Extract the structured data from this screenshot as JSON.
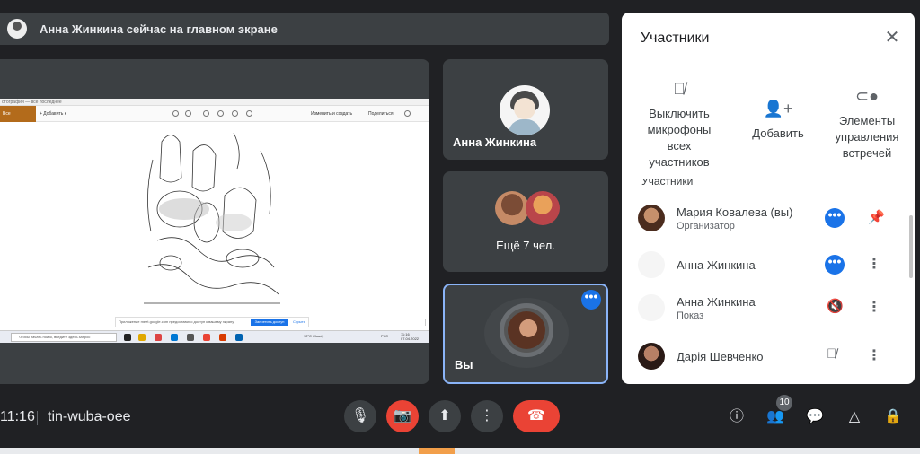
{
  "banner": {
    "text": "Анна Жинкина сейчас на главном экране"
  },
  "presentation": {
    "window_title": "отографии — все последнее",
    "gallery_button": "Все фотографии",
    "add_label": "+ Добавить к",
    "edit_label": "Изменить и создать",
    "share_label": "Поделиться",
    "notice_text": "Приложение meet.google.com предоставило доступ к вашему экрану.",
    "notice_allow": "Запретить доступ",
    "notice_hide": "Скрыть",
    "taskbar_search": "Чтобы начать поиск, введите здесь запрос",
    "taskbar_weather": "12°C Cloudy",
    "taskbar_lang": "РУС",
    "taskbar_time": "11:16",
    "taskbar_date": "07.04.2022"
  },
  "tiles": [
    {
      "name": "Анна Жинкина"
    },
    {
      "name": "Ещё 7 чел."
    },
    {
      "name": "Вы"
    }
  ],
  "panel": {
    "title": "Участники",
    "actions": [
      {
        "icon": "mic-off-icon",
        "label": "Выключить микрофоны всех участников"
      },
      {
        "icon": "add-person-icon",
        "label": "Добавить"
      },
      {
        "icon": "toggle-icon",
        "label": "Элементы управления встречей"
      }
    ],
    "section_label": "Участники",
    "people": [
      {
        "name": "Мария Ковалева (вы)",
        "sub": "Организатор"
      },
      {
        "name": "Анна Жинкина",
        "sub": ""
      },
      {
        "name": "Анна Жинкина",
        "sub": "Показ"
      },
      {
        "name": "Дарія Шевченко",
        "sub": ""
      }
    ]
  },
  "bottom": {
    "time": "11:16",
    "meeting_code": "tin-wuba-oee",
    "people_count": "10"
  },
  "colors": {
    "accent": "#1a73e8",
    "danger": "#ea4335",
    "tile_bg": "#3c4043",
    "bg": "#202124",
    "selected_border": "#8ab4f8"
  }
}
